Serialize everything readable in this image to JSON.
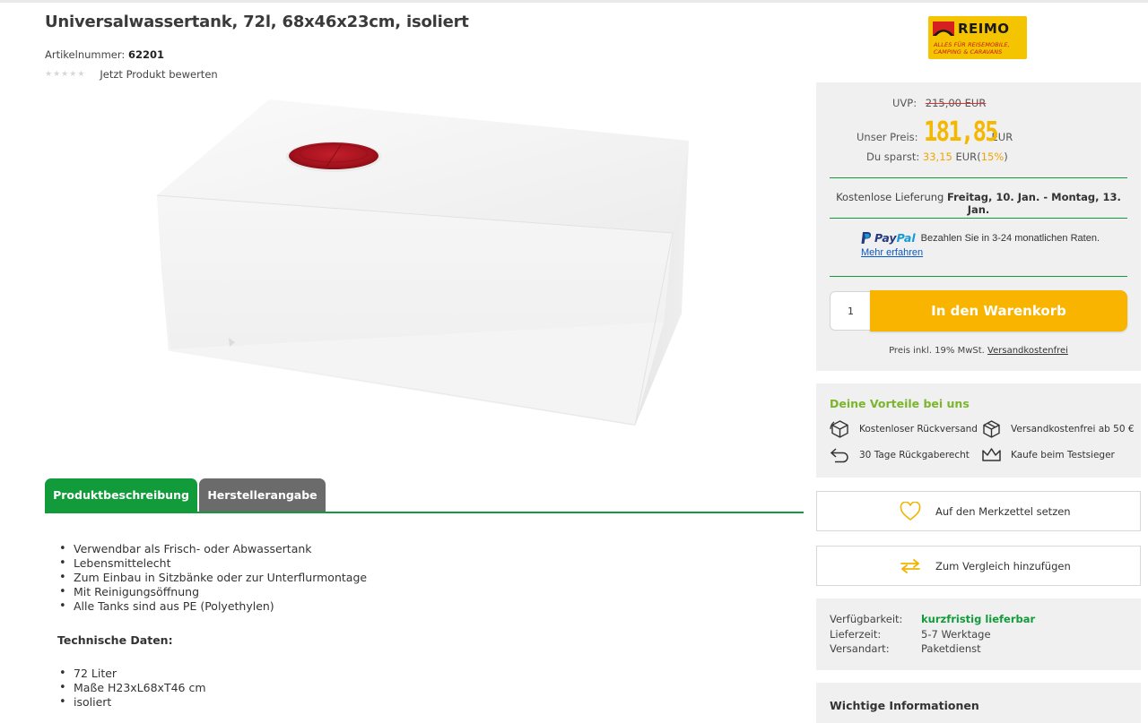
{
  "product": {
    "title": "Universalwassertank, 72l, 68x46x23cm, isoliert",
    "artnr_label": "Artikelnummer:",
    "artnr_value": "62201",
    "rating_link": "Jetzt Produkt bewerten",
    "stars_rating": 0,
    "stars_total": 5
  },
  "logo": {
    "word": "REIMO",
    "tagline_1": "ALLES FÜR REISEMOBILE,",
    "tagline_2": "CAMPING & CARAVANS"
  },
  "tabs": [
    {
      "label": "Produktbeschreibung",
      "active": true
    },
    {
      "label": "Herstellerangabe",
      "active": false
    }
  ],
  "description": {
    "bullets": [
      "Verwendbar als Frisch- oder Abwassertank",
      "Lebensmittelecht",
      "Zum Einbau in Sitzbänke oder zur Unterflurmontage",
      "Mit Reinigungsöffnung",
      "Alle Tanks sind aus PE (Polyethylen)"
    ],
    "tech_title": "Technische Daten:",
    "tech_bullets": [
      "72 Liter",
      "Maße H23xL68xT46 cm",
      "isoliert"
    ]
  },
  "pricing": {
    "uvp_label": "UVP:",
    "uvp_value": "215,00 EUR",
    "price_label": "Unser Preis:",
    "price_value": "181,85",
    "price_currency": "EUR",
    "save_label": "Du sparst:",
    "save_amount": "33,15",
    "save_currency": "EUR",
    "save_open": "(",
    "save_percent": "15%",
    "save_close": ")",
    "price_color": "#f5b800"
  },
  "delivery": {
    "prefix": "Kostenlose Lieferung",
    "dates": "Freitag, 10. Jan. - Montag, 13. Jan."
  },
  "paypal": {
    "logo_1": "Pay",
    "logo_2": "Pal",
    "text": "Bezahlen Sie in 3-24 monatlichen Raten.",
    "link": "Mehr erfahren"
  },
  "cart": {
    "quantity": "1",
    "button_label": "In den Warenkorb",
    "button_color": "#f9b400",
    "vat_text": "Preis inkl. 19% MwSt.",
    "vat_link": "Versandkostenfrei"
  },
  "benefits": {
    "title": "Deine Vorteile bei uns",
    "items": [
      {
        "label": "Kostenloser Rückversand",
        "icon": "box-return-icon"
      },
      {
        "label": "Versandkostenfrei ab 50 €",
        "icon": "package-icon"
      },
      {
        "label": "30 Tage Rückgaberecht",
        "icon": "return-arrow-icon"
      },
      {
        "label": "Kaufe beim Testsieger",
        "icon": "crown-icon"
      }
    ]
  },
  "actions": {
    "wishlist": "Auf den Merkzettel setzen",
    "compare": "Zum Vergleich hinzufügen"
  },
  "availability": {
    "rows": [
      {
        "label": "Verfügbarkeit:",
        "value": "kurzfristig lieferbar"
      },
      {
        "label": "Lieferzeit:",
        "value": "5-7 Werktage"
      },
      {
        "label": "Versandart:",
        "value": "Paketdienst"
      }
    ]
  },
  "info": {
    "title": "Wichtige Informationen"
  },
  "colors": {
    "green": "#119b3a",
    "orange": "#f0a500",
    "benefit_green": "#7bb52c"
  }
}
